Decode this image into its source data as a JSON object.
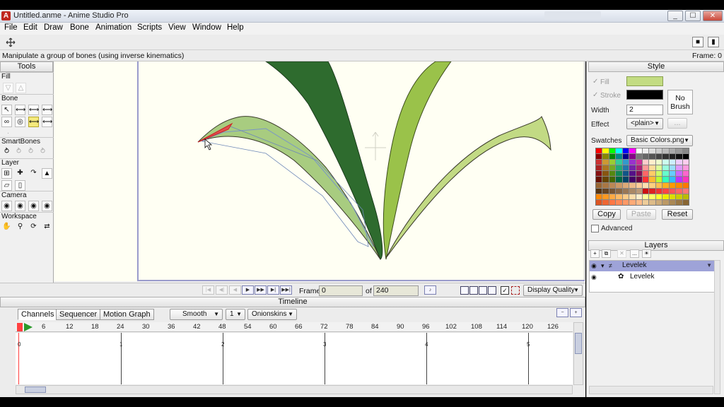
{
  "window": {
    "app_icon": "A",
    "title": "Untitled.anme - Anime Studio Pro",
    "controls": [
      "_",
      "☐",
      "✕"
    ]
  },
  "menu": [
    "File",
    "Edit",
    "Draw",
    "Bone",
    "Animation",
    "Scripts",
    "View",
    "Window",
    "Help"
  ],
  "status": {
    "message": "Manipulate a group of bones (using inverse kinematics)",
    "frame": "Frame: 0"
  },
  "tools": {
    "title": "Tools",
    "groups": {
      "fill": "Fill",
      "bone": "Bone",
      "smartbones": "SmartBones",
      "layer": "Layer",
      "camera": "Camera",
      "workspace": "Workspace"
    }
  },
  "playback": {
    "frame_label": "Frame",
    "frame_value": "0",
    "of_label": "of",
    "total_frames": "240",
    "display_quality": "Display Quality"
  },
  "timeline": {
    "title": "Timeline",
    "tabs": [
      "Channels",
      "Sequencer",
      "Motion Graph"
    ],
    "interpolation": "Smooth",
    "step": "1",
    "onionskins": "Onionskins",
    "ruler_ticks": [
      "6",
      "12",
      "18",
      "24",
      "30",
      "36",
      "42",
      "48",
      "54",
      "60",
      "66",
      "72",
      "78",
      "84",
      "90",
      "96",
      "102",
      "108",
      "114",
      "120",
      "126"
    ],
    "seconds": [
      "0",
      "1",
      "2",
      "3",
      "4",
      "5"
    ]
  },
  "style": {
    "title": "Style",
    "fill_label": "Fill",
    "stroke_label": "Stroke",
    "width_label": "Width",
    "width_value": "2",
    "effect_label": "Effect",
    "effect_value": "<plain>",
    "no_brush": "No Brush",
    "swatches_label": "Swatches",
    "swatches_value": "Basic Colors.png",
    "copy": "Copy",
    "paste": "Paste",
    "reset": "Reset",
    "advanced": "Advanced",
    "fill_color": "#c3dc82",
    "stroke_color": "#000000"
  },
  "layers": {
    "title": "Layers",
    "items": [
      {
        "name": "Levelek",
        "type": "bone-layer",
        "selected": true
      },
      {
        "name": "Levelek",
        "type": "vector-layer",
        "selected": false
      }
    ]
  }
}
